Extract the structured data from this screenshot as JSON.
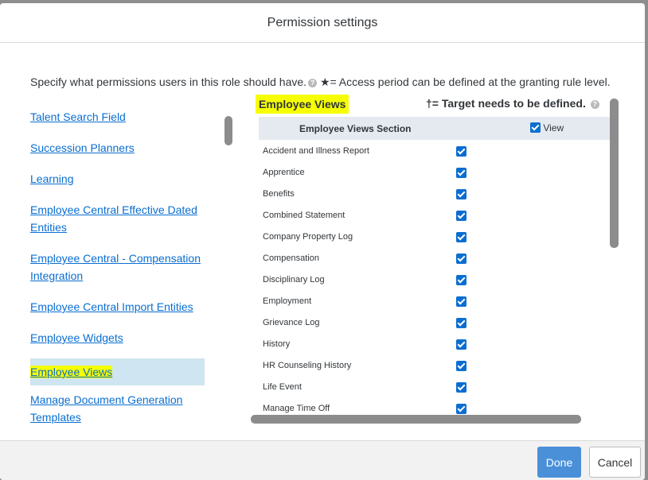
{
  "dialog": {
    "title": "Permission settings",
    "description": "Specify what permissions users in this role should have.",
    "help_icon": "?",
    "star_note": "★= Access period can be defined at the granting rule level."
  },
  "left_nav": {
    "items": [
      "Talent Search Field",
      "Succession Planners",
      "Learning",
      "Employee Central Effective Dated Entities",
      "Employee Central - Compensation Integration",
      "Employee Central Import Entities",
      "Employee Widgets",
      "Employee Views",
      "Manage Document Generation Templates"
    ],
    "selected": "Employee Views"
  },
  "section": {
    "title": "Employee Views",
    "target_note": "†= Target needs to be defined.",
    "column_header": "Employee Views Section",
    "view_header": "View",
    "view_all_checked": true,
    "rows": [
      {
        "label": "Accident and Illness Report",
        "checked": true
      },
      {
        "label": "Apprentice",
        "checked": true
      },
      {
        "label": "Benefits",
        "checked": true
      },
      {
        "label": "Combined Statement",
        "checked": true
      },
      {
        "label": "Company Property Log",
        "checked": true
      },
      {
        "label": "Compensation",
        "checked": true
      },
      {
        "label": "Disciplinary Log",
        "checked": true
      },
      {
        "label": "Employment",
        "checked": true
      },
      {
        "label": "Grievance Log",
        "checked": true
      },
      {
        "label": "History",
        "checked": true
      },
      {
        "label": "HR Counseling History",
        "checked": true
      },
      {
        "label": "Life Event",
        "checked": true
      },
      {
        "label": "Manage Time Off",
        "checked": true
      }
    ]
  },
  "footer": {
    "done_label": "Done",
    "cancel_label": "Cancel"
  },
  "colors": {
    "accent": "#0a6ed1",
    "highlight": "#f6ff00",
    "selected_bg": "#cfe5f1"
  }
}
